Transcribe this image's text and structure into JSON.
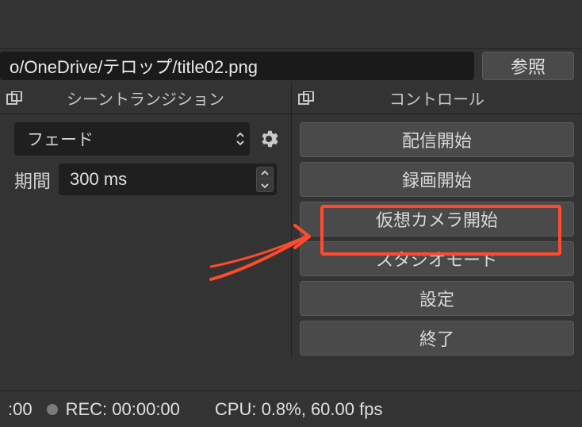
{
  "file_path": "o/OneDrive/テロップ/title02.png",
  "browse_label": "参照",
  "transitions": {
    "panel_title": "シーントランジション",
    "selected": "フェード",
    "duration_label": "期間",
    "duration_value": "300 ms"
  },
  "controls": {
    "panel_title": "コントロール",
    "buttons": [
      "配信開始",
      "録画開始",
      "仮想カメラ開始",
      "スタジオモード",
      "設定",
      "終了"
    ]
  },
  "status": {
    "time_partial": ":00",
    "rec_label": "REC: 00:00:00",
    "cpu_label": "CPU: 0.8%, 60.00 fps"
  },
  "colors": {
    "highlight": "#ff4a2e",
    "bg": "#333333",
    "input_bg": "#1a1a1a",
    "btn_bg": "#4a4a4a"
  }
}
